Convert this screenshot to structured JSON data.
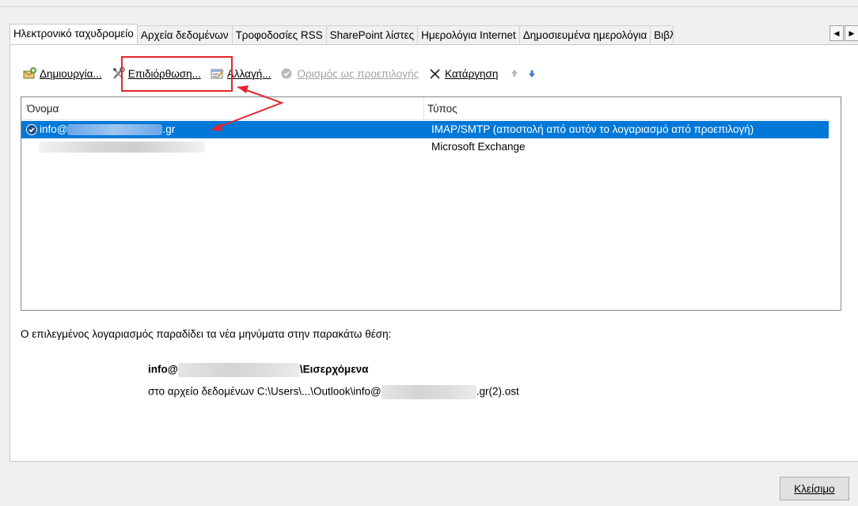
{
  "tabs": [
    "Ηλεκτρονικό ταχυδρομείο",
    "Αρχεία δεδομένων",
    "Τροφοδοσίες RSS",
    "SharePoint λίστες",
    "Ημερολόγια Internet",
    "Δημοσιευμένα ημερολόγια",
    "Βιβλία διευθύνσεων"
  ],
  "toolbar": {
    "new_label": "Δημιουργία...",
    "repair_label": "Επιδιόρθωση...",
    "change_label": "Αλλαγή...",
    "set_default_label": "Ορισμός ως προεπιλογής",
    "remove_label": "Κατάργηση",
    "icons": [
      "new-account-icon",
      "repair-tools-icon",
      "change-icon",
      "check-circle-icon",
      "remove-x-icon",
      "move-up-icon",
      "move-down-icon"
    ]
  },
  "list": {
    "col_name": "Όνομα",
    "col_type": "Τύπος",
    "rows": [
      {
        "name_prefix": "info@",
        "name_suffix": ".gr",
        "type": "IMAP/SMTP (αποστολή από αυτόν το λογαριασμό από προεπιλογή)",
        "selected": true,
        "default": true
      },
      {
        "name_prefix": "",
        "name_suffix": "",
        "type": "Microsoft Exchange",
        "selected": false,
        "default": false
      }
    ]
  },
  "delivery": {
    "intro": "Ο επιλεγμένος λογαριασμός παραδίδει τα νέα μηνύματα στην παρακάτω θέση:",
    "account_prefix": "info@",
    "account_suffix": "\\Εισερχόμενα",
    "file_prefix": "στο αρχείο δεδομένων C:\\Users\\...\\Outlook\\info@",
    "file_suffix": ".gr(2).ost"
  },
  "close_label": "Κλείσιμο",
  "colors": {
    "selection": "#0078d7",
    "annotation": "#e3262e",
    "arrow_blue": "#2b6cd9"
  }
}
